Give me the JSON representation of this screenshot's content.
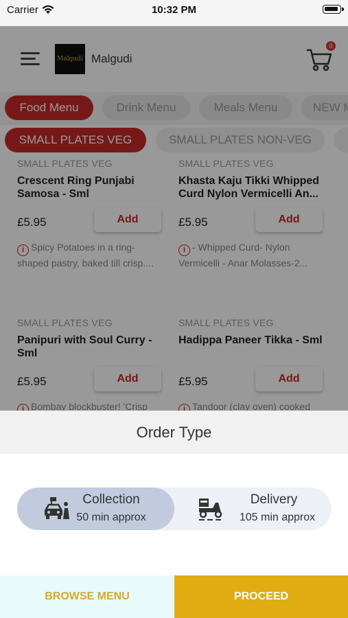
{
  "status_bar": {
    "carrier": "Carrier",
    "time": "10:32 PM"
  },
  "header": {
    "logo_text": "Malgudi",
    "brand": "Malgudi",
    "cart_count": "0"
  },
  "menu_tabs": [
    {
      "label": "Food Menu",
      "active": true
    },
    {
      "label": "Drink Menu",
      "active": false
    },
    {
      "label": "Meals Menu",
      "active": false
    },
    {
      "label": "NEW M",
      "active": false
    }
  ],
  "sub_tabs": [
    {
      "label": "SMALL PLATES VEG",
      "active": true
    },
    {
      "label": "SMALL PLATES NON-VEG",
      "active": false
    }
  ],
  "products": [
    {
      "category": "SMALL PLATES VEG",
      "name": "Crescent Ring Punjabi Samosa - Sml",
      "price": "£5.95",
      "add_label": "Add",
      "desc": "Spicy Potatoes in a ring-shaped pastry, baked till crisp...."
    },
    {
      "category": "SMALL PLATES VEG",
      "name": "Khasta Kaju Tikki Whipped Curd Nylon Vermicelli An...",
      "price": "£5.95",
      "add_label": "Add",
      "desc": "- Whipped Curd- Nylon Vermicelli - Anar Molasses-2..."
    },
    {
      "category": "SMALL PLATES VEG",
      "name": "Panipuri with Soul Curry - Sml",
      "price": "£5.95",
      "add_label": "Add",
      "desc": "Bombay blockbuster! 'Crisp"
    },
    {
      "category": "SMALL PLATES VEG",
      "name": "Hadippa Paneer Tikka - Sml",
      "price": "£5.95",
      "add_label": "Add",
      "desc": "Tandoor (clay oven) cooked"
    }
  ],
  "order_sheet": {
    "title": "Order Type",
    "options": [
      {
        "label": "Collection",
        "time": "50 min approx",
        "icon": "car-collection-icon",
        "selected": true
      },
      {
        "label": "Delivery",
        "time": "105 min approx",
        "icon": "delivery-scooter-icon",
        "selected": false
      }
    ]
  },
  "actions": {
    "browse": "BROWSE MENU",
    "proceed": "PROCEED"
  },
  "colors": {
    "accent": "#c62828",
    "proceed": "#e0ac12",
    "browse_text": "#d4a92a",
    "selected_option": "#c2cade"
  }
}
